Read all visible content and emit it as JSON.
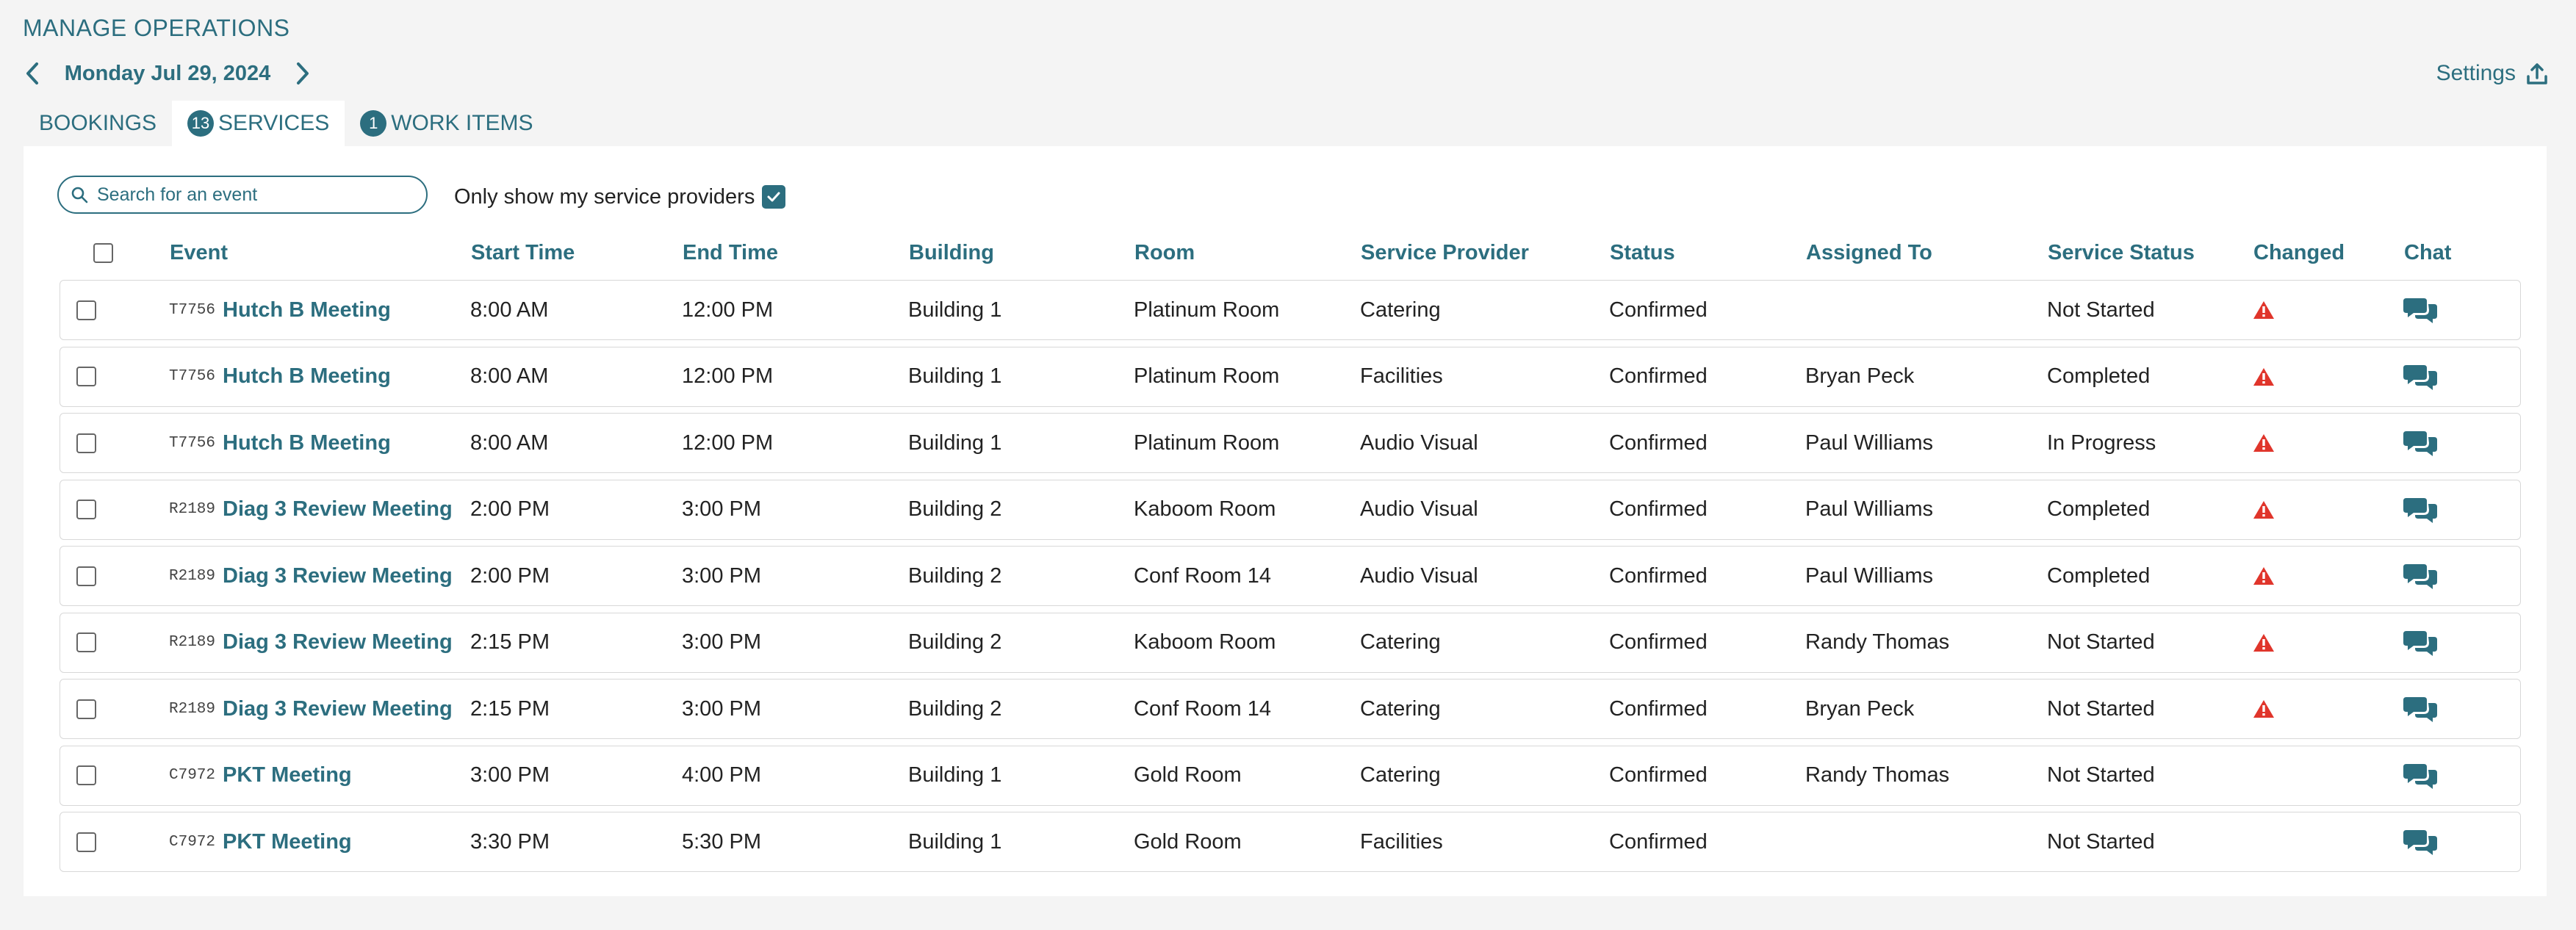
{
  "page": {
    "title": "MANAGE OPERATIONS"
  },
  "date_nav": {
    "date": "Monday Jul 29, 2024"
  },
  "settings": {
    "label": "Settings"
  },
  "tabs": [
    {
      "label": "BOOKINGS",
      "badge": ""
    },
    {
      "label": "SERVICES",
      "badge": "13",
      "active": true
    },
    {
      "label": "WORK ITEMS",
      "badge": "1"
    }
  ],
  "search": {
    "placeholder": "Search for an event",
    "value": ""
  },
  "filter": {
    "only_mine_label": "Only show my service providers",
    "only_mine_checked": true
  },
  "columns": [
    "Event",
    "Start Time",
    "End Time",
    "Building",
    "Room",
    "Service Provider",
    "Status",
    "Assigned To",
    "Service Status",
    "Changed",
    "Chat"
  ],
  "rows": [
    {
      "code": "T7756",
      "event": "Hutch B Meeting",
      "start": "8:00 AM",
      "end": "12:00 PM",
      "building": "Building 1",
      "room": "Platinum Room",
      "provider": "Catering",
      "status": "Confirmed",
      "assigned": "",
      "service_status": "Not Started",
      "changed": true
    },
    {
      "code": "T7756",
      "event": "Hutch B Meeting",
      "start": "8:00 AM",
      "end": "12:00 PM",
      "building": "Building 1",
      "room": "Platinum Room",
      "provider": "Facilities",
      "status": "Confirmed",
      "assigned": "Bryan Peck",
      "service_status": "Completed",
      "changed": true
    },
    {
      "code": "T7756",
      "event": "Hutch B Meeting",
      "start": "8:00 AM",
      "end": "12:00 PM",
      "building": "Building 1",
      "room": "Platinum Room",
      "provider": "Audio Visual",
      "status": "Confirmed",
      "assigned": "Paul Williams",
      "service_status": "In Progress",
      "changed": true
    },
    {
      "code": "R2189",
      "event": "Diag 3 Review Meeting",
      "start": "2:00 PM",
      "end": "3:00 PM",
      "building": "Building 2",
      "room": "Kaboom Room",
      "provider": "Audio Visual",
      "status": "Confirmed",
      "assigned": "Paul Williams",
      "service_status": "Completed",
      "changed": true
    },
    {
      "code": "R2189",
      "event": "Diag 3 Review Meeting",
      "start": "2:00 PM",
      "end": "3:00 PM",
      "building": "Building 2",
      "room": "Conf Room 14",
      "provider": "Audio Visual",
      "status": "Confirmed",
      "assigned": "Paul Williams",
      "service_status": "Completed",
      "changed": true
    },
    {
      "code": "R2189",
      "event": "Diag 3 Review Meeting",
      "start": "2:15 PM",
      "end": "3:00 PM",
      "building": "Building 2",
      "room": "Kaboom Room",
      "provider": "Catering",
      "status": "Confirmed",
      "assigned": "Randy Thomas",
      "service_status": "Not Started",
      "changed": true
    },
    {
      "code": "R2189",
      "event": "Diag 3 Review Meeting",
      "start": "2:15 PM",
      "end": "3:00 PM",
      "building": "Building 2",
      "room": "Conf Room 14",
      "provider": "Catering",
      "status": "Confirmed",
      "assigned": "Bryan Peck",
      "service_status": "Not Started",
      "changed": true
    },
    {
      "code": "C7972",
      "event": "PKT Meeting",
      "start": "3:00 PM",
      "end": "4:00 PM",
      "building": "Building 1",
      "room": "Gold Room",
      "provider": "Catering",
      "status": "Confirmed",
      "assigned": "Randy Thomas",
      "service_status": "Not Started",
      "changed": false
    },
    {
      "code": "C7972",
      "event": "PKT Meeting",
      "start": "3:30 PM",
      "end": "5:30 PM",
      "building": "Building 1",
      "room": "Gold Room",
      "provider": "Facilities",
      "status": "Confirmed",
      "assigned": "",
      "service_status": "Not Started",
      "changed": false
    }
  ],
  "colors": {
    "accent": "#2c6e7f",
    "warning": "#e0352b",
    "background": "#f4f4f4"
  },
  "icons": [
    "chevron-left-icon",
    "chevron-right-icon",
    "upload-icon",
    "search-icon",
    "checkmark-icon",
    "warning-icon",
    "chat-icon"
  ]
}
